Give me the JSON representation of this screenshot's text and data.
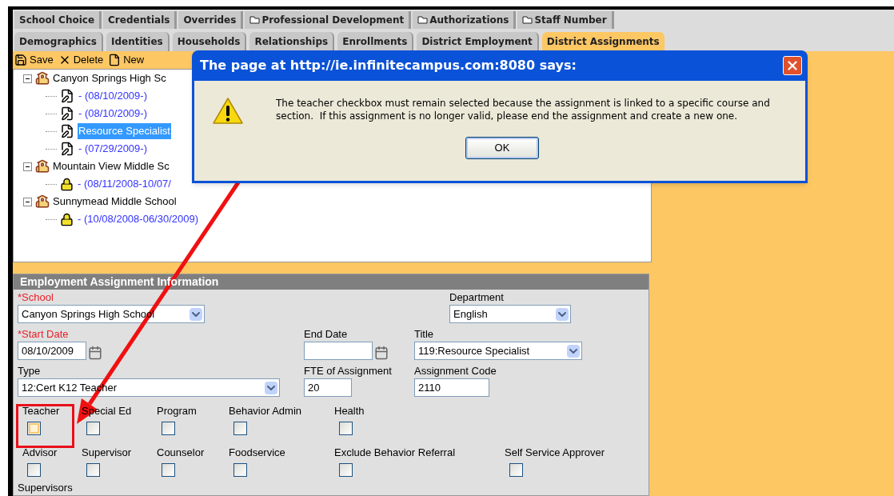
{
  "tabs_row_1": [
    {
      "label": "School Choice",
      "has_icon": false,
      "selected": false
    },
    {
      "label": "Credentials",
      "has_icon": false,
      "selected": false
    },
    {
      "label": "Overrides",
      "has_icon": false,
      "selected": false
    },
    {
      "label": "Professional Development",
      "has_icon": true,
      "selected": false
    },
    {
      "label": "Authorizations",
      "has_icon": true,
      "selected": false
    },
    {
      "label": "Staff Number",
      "has_icon": true,
      "selected": false
    }
  ],
  "tabs_row_2": [
    {
      "label": "Demographics",
      "selected": false
    },
    {
      "label": "Identities",
      "selected": false
    },
    {
      "label": "Households",
      "selected": false
    },
    {
      "label": "Relationships",
      "selected": false
    },
    {
      "label": "Enrollments",
      "selected": false
    },
    {
      "label": "District Employment",
      "selected": false
    },
    {
      "label": "District Assignments",
      "selected": true
    }
  ],
  "toolbar": [
    {
      "kind": "save",
      "label": "Save"
    },
    {
      "kind": "delete",
      "label": "Delete"
    },
    {
      "kind": "new",
      "label": "New"
    }
  ],
  "tree": [
    {
      "kind": "school",
      "label": "Canyon Springs High Sc",
      "expanded": true,
      "children": [
        {
          "kind": "assignment",
          "label": "- (08/10/2009-)",
          "selected": false
        },
        {
          "kind": "assignment",
          "label": "- (08/10/2009-)",
          "selected": false
        },
        {
          "kind": "assignment",
          "label": "Resource Specialist",
          "selected": true
        },
        {
          "kind": "assignment",
          "label": "- (07/29/2009-)",
          "selected": false
        }
      ]
    },
    {
      "kind": "school",
      "label": "Mountain View Middle Sc",
      "expanded": true,
      "children": [
        {
          "kind": "locked",
          "label": "- (08/11/2008-10/07/",
          "selected": false
        }
      ]
    },
    {
      "kind": "school",
      "label": "Sunnymead Middle School",
      "expanded": true,
      "children": [
        {
          "kind": "locked",
          "label": "- (10/08/2008-06/30/2009)",
          "selected": false
        }
      ]
    }
  ],
  "form": {
    "title": "Employment Assignment Information",
    "fields": [
      {
        "label": "*School",
        "required": true,
        "kind": "select",
        "value": "Canyon Springs High School"
      },
      {
        "label": "Department",
        "required": false,
        "kind": "select",
        "value": "English"
      },
      {
        "label": "*Start Date",
        "required": true,
        "kind": "date",
        "value": "08/10/2009"
      },
      {
        "label": "End Date",
        "required": false,
        "kind": "date"
      },
      {
        "label": "Title",
        "required": false,
        "kind": "select",
        "value": "119:Resource Specialist"
      },
      {
        "label": "Type",
        "required": false,
        "kind": "select",
        "value": "12:Cert K12 Teacher"
      },
      {
        "label": "FTE of Assignment",
        "required": false,
        "kind": "text",
        "value": "20"
      },
      {
        "label": "Assignment Code",
        "required": false,
        "kind": "text",
        "value": "2110"
      }
    ],
    "checkbox_rows": [
      [
        {
          "label": "Teacher",
          "checked": false,
          "highlighted": true
        },
        {
          "label": "Special Ed",
          "checked": false,
          "highlighted": false
        },
        {
          "label": "Program",
          "checked": false,
          "highlighted": false
        },
        {
          "label": "Behavior Admin",
          "checked": false,
          "highlighted": false
        },
        {
          "label": "Health",
          "checked": false,
          "highlighted": false
        }
      ],
      [
        {
          "label": "Advisor",
          "checked": false,
          "highlighted": false
        },
        {
          "label": "Supervisor",
          "checked": false,
          "highlighted": false
        },
        {
          "label": "Counselor",
          "checked": false,
          "highlighted": false
        },
        {
          "label": "Foodservice",
          "checked": false,
          "highlighted": false
        },
        {
          "label": "Exclude Behavior Referral",
          "checked": false,
          "highlighted": false
        },
        {
          "label": "Self Service Approver",
          "checked": false,
          "highlighted": false
        }
      ]
    ],
    "next_label": "Supervisors"
  },
  "dialog": {
    "title": "The page at http://ie.infinitecampus.com:8080 says:",
    "message": "The teacher checkbox must remain selected because the assignment is linked to a specific course and section.  If this assignment is no longer valid, please end the assignment and create a new one.",
    "button": "OK"
  },
  "annotation": {
    "arrow": true,
    "highlight": true
  }
}
